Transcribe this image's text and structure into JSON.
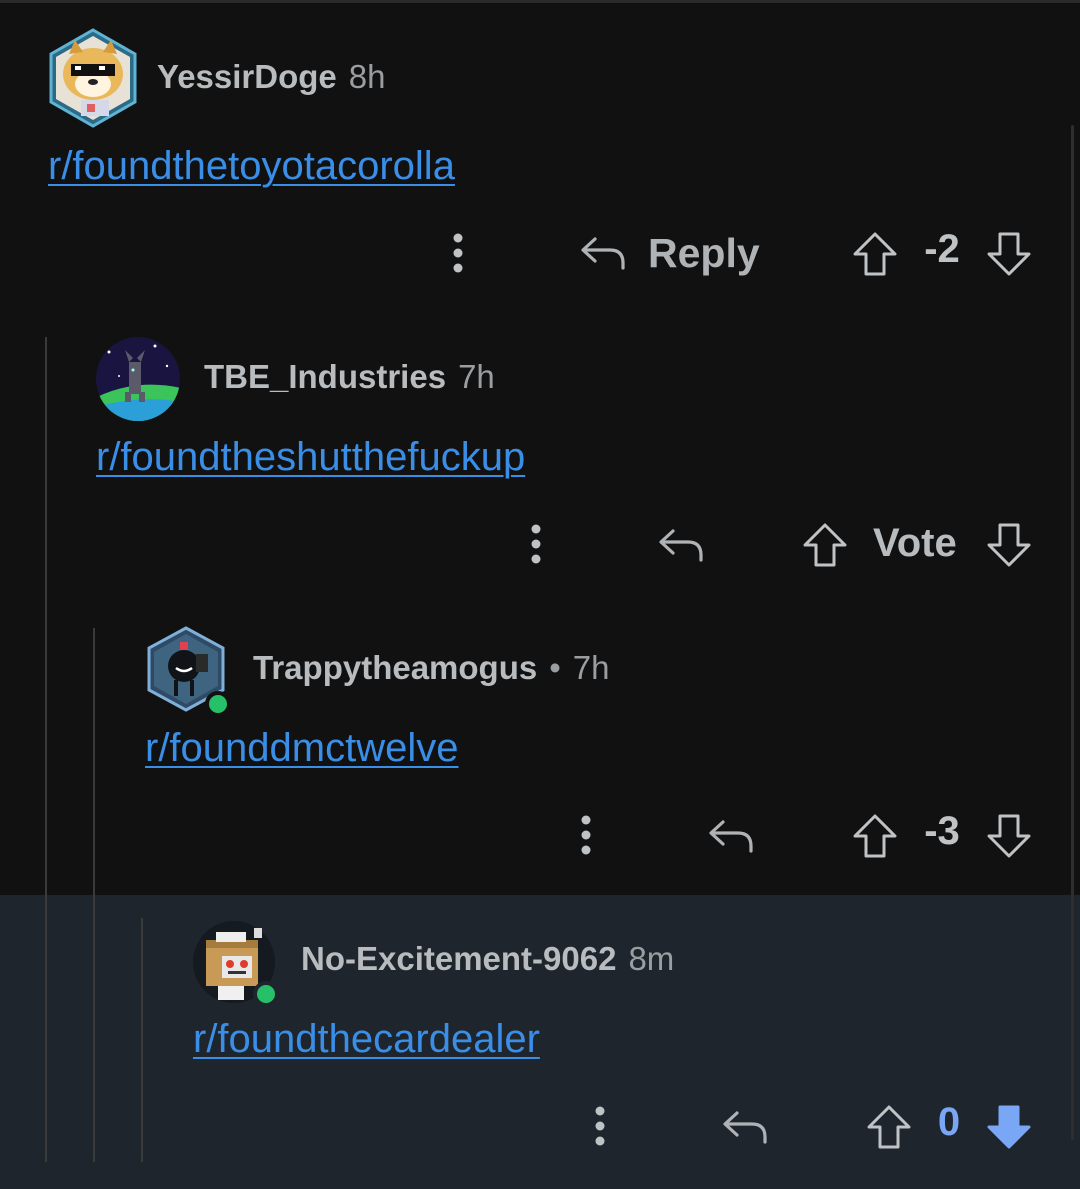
{
  "comments": [
    {
      "username": "YessirDoge",
      "time": "8h",
      "link": "r/foundthetoyotacorolla",
      "reply_label": "Reply",
      "score": "-2",
      "avatar_icon": "doge-sunglasses-avatar-icon"
    },
    {
      "username": "TBE_Industries",
      "time": "7h",
      "link": "r/foundtheshutthefuckup",
      "vote_label": "Vote",
      "avatar_icon": "space-creature-avatar-icon"
    },
    {
      "username": "Trappytheamogus",
      "separator": "•",
      "time": "7h",
      "link": "r/founddmctwelve",
      "score": "-3",
      "avatar_icon": "robot-avatar-icon"
    },
    {
      "username": "No-Excitement-9062",
      "time": "8m",
      "link": "r/foundthecardealer",
      "score": "0",
      "avatar_icon": "box-robot-avatar-icon",
      "downvoted": true
    }
  ],
  "colors": {
    "background": "#111111",
    "highlight_background": "#1f252d",
    "link": "#3a8ee6",
    "downvote_active": "#7aa7f5",
    "online": "#26c068"
  }
}
